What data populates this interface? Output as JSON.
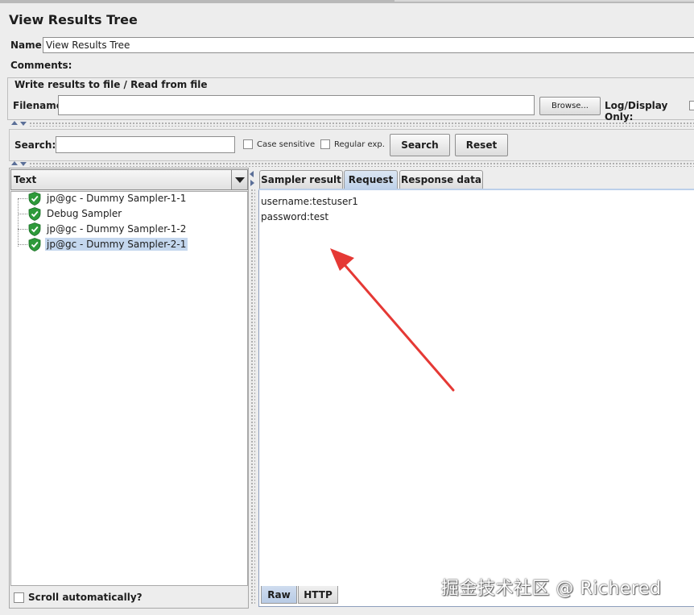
{
  "page": {
    "title": "View Results Tree"
  },
  "name_field": {
    "label": "Name:",
    "value": "View Results Tree"
  },
  "comments_field": {
    "label": "Comments:"
  },
  "file_group": {
    "title": "Write results to file / Read from file",
    "filename_label": "Filename",
    "filename_value": "",
    "browse_label": "Browse...",
    "log_display_label": "Log/Display Only:"
  },
  "search": {
    "label": "Search:",
    "value": "",
    "case_sensitive_label": "Case sensitive",
    "regular_exp_label": "Regular exp.",
    "search_button": "Search",
    "reset_button": "Reset"
  },
  "renderer": {
    "selected": "Text"
  },
  "tree": {
    "items": [
      {
        "label": "jp@gc - Dummy Sampler-1-1",
        "status": "success",
        "selected": false
      },
      {
        "label": "Debug Sampler",
        "status": "success",
        "selected": false
      },
      {
        "label": "jp@gc - Dummy Sampler-1-2",
        "status": "success",
        "selected": false
      },
      {
        "label": "jp@gc - Dummy Sampler-2-1",
        "status": "success",
        "selected": true
      }
    ]
  },
  "scroll_auto": {
    "label": "Scroll automatically?",
    "checked": false
  },
  "tabs": [
    {
      "label": "Sampler result",
      "active": false
    },
    {
      "label": "Request",
      "active": true
    },
    {
      "label": "Response data",
      "active": false
    }
  ],
  "request_content": {
    "lines": [
      "username:testuser1",
      "password:test"
    ]
  },
  "bottom_tabs": [
    {
      "label": "Raw",
      "active": true
    },
    {
      "label": "HTTP",
      "active": false
    }
  ],
  "watermark": "掘金技术社区 @ Richered",
  "colors": {
    "background": "#ededed",
    "selection": "#c4d7ee",
    "active_tab": "#c4d5ec",
    "success_green": "#2e9a3a",
    "annotation_arrow": "#e53935"
  }
}
